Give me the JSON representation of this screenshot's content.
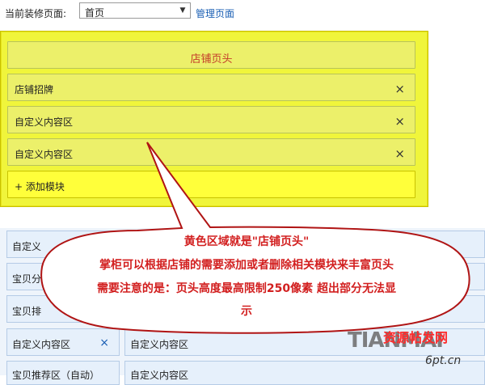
{
  "topbar": {
    "label": "当前装修页面:",
    "select_value": "首页",
    "manage_link": "管理页面"
  },
  "header_area": {
    "title": "店铺页头",
    "modules": [
      {
        "label": "店铺招牌",
        "remove": "×"
      },
      {
        "label": "自定义内容区",
        "remove": "×"
      },
      {
        "label": "自定义内容区",
        "remove": "×"
      }
    ],
    "add_module": "+ 添加模块"
  },
  "body_area": {
    "rows": [
      {
        "label": "自定义"
      },
      {
        "label": "宝贝分"
      },
      {
        "label": "宝贝排"
      }
    ],
    "bottom_row": {
      "left_label": "自定义内容区",
      "left_remove": "×",
      "right_label": "自定义内容区"
    },
    "partial_row": {
      "left_label": "宝贝推荐区（自动）",
      "right_label": "自定义内容区"
    }
  },
  "callout": {
    "line1": "黄色区域就是\"店铺页头\"",
    "line2": "掌柜可以根据店铺的需要添加或者删除相关模块来丰富页头",
    "line3": "需要注意的是：页头高度最高限制250像素 超出部分无法显",
    "line4": "示"
  },
  "watermark": {
    "brand": "TIANMAI",
    "cn": "资源帖发网",
    "url": "6pt.cn"
  },
  "colors": {
    "header_yellow": "#f0f53b",
    "callout_red": "#d21f1f",
    "link_blue": "#1a5fb4"
  }
}
